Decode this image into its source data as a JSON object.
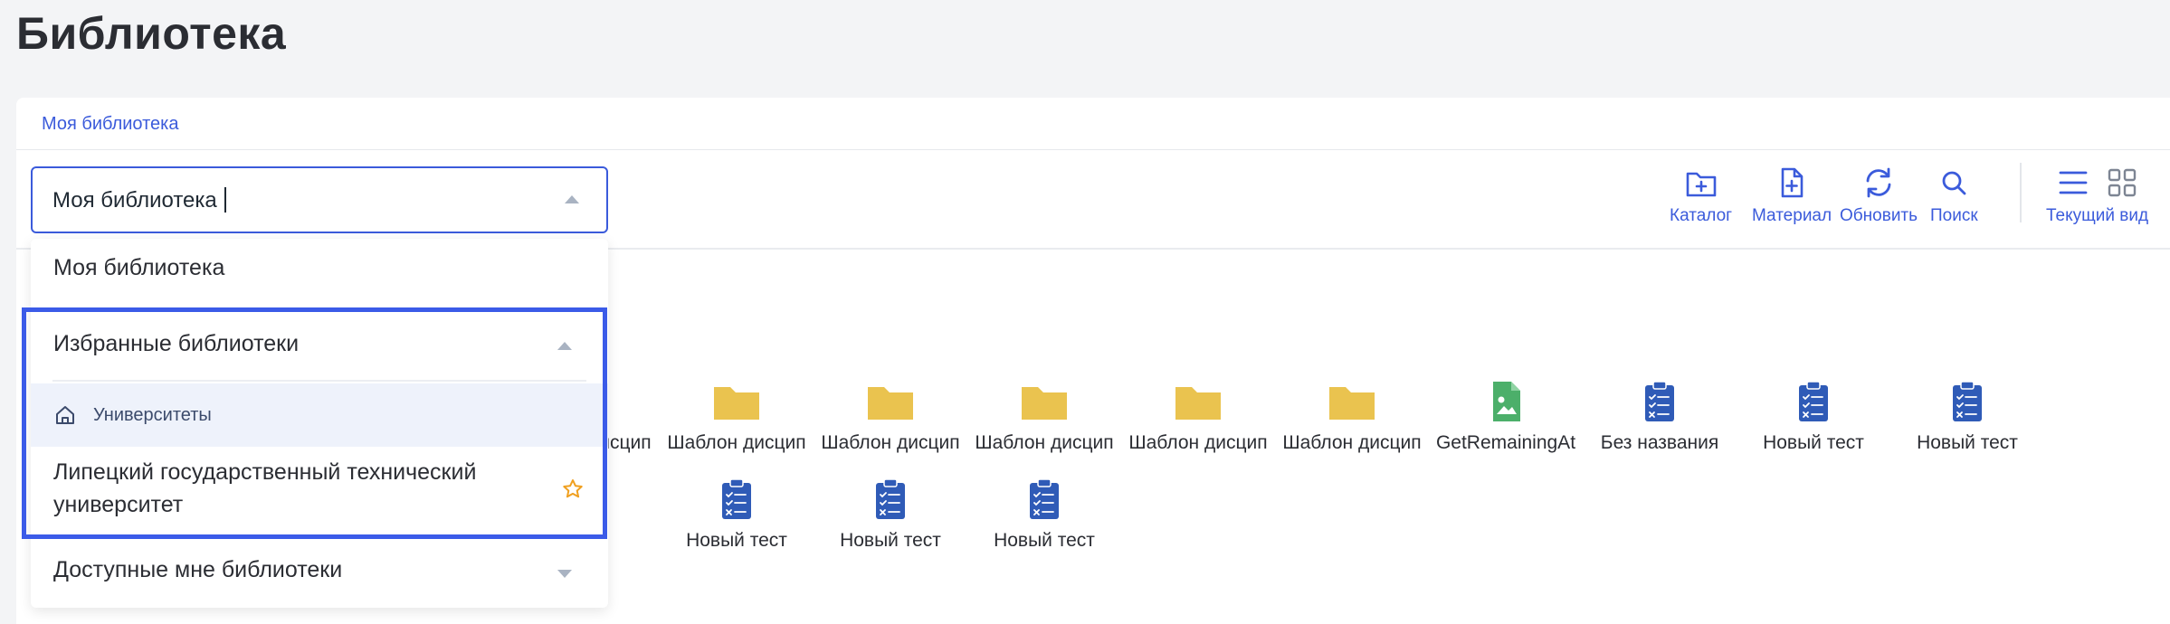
{
  "page": {
    "title": "Библиотека"
  },
  "breadcrumb": {
    "label": "Моя библиотека"
  },
  "toolbar": {
    "catalog": "Каталог",
    "material": "Материал",
    "refresh": "Обновить",
    "search": "Поиск",
    "view": "Текущий вид"
  },
  "selector": {
    "value": "Моя библиотека",
    "options": {
      "my": "Моя библиотека",
      "favorites": "Избранные библиотеки",
      "universities": "Университеты",
      "lgtu": "Липецкий государственный технический университет",
      "available": "Доступные мне библиотеки"
    }
  },
  "items": [
    {
      "label": "Шаблон дисцип",
      "icon": "folder-icon"
    },
    {
      "label": "Шаблон дисцип",
      "icon": "folder-icon"
    },
    {
      "label": "Шаблон дисцип",
      "icon": "folder-icon"
    },
    {
      "label": "Шаблон дисцип",
      "icon": "folder-icon"
    },
    {
      "label": "Шаблон дисцип",
      "icon": "folder-icon"
    },
    {
      "label": "Шаблон дисцип",
      "icon": "folder-icon"
    },
    {
      "label": "GetRemainingAt",
      "icon": "image-file-icon"
    },
    {
      "label": "Без названия",
      "icon": "test-icon"
    },
    {
      "label": "Новый тест",
      "icon": "test-icon"
    },
    {
      "label": "Новый тест",
      "icon": "test-icon"
    },
    {
      "label": "ест",
      "icon": "test-icon"
    },
    {
      "label": "Новый тест",
      "icon": "test-icon"
    },
    {
      "label": "Новый тест",
      "icon": "test-icon"
    },
    {
      "label": "Новый тест",
      "icon": "test-icon"
    }
  ],
  "colors": {
    "accent": "#3b5bdb",
    "folder": "#eac34f",
    "image_file": "#4caf6a",
    "test": "#2f5bb7",
    "highlight": "#3b5be8",
    "star": "#f0a020"
  }
}
